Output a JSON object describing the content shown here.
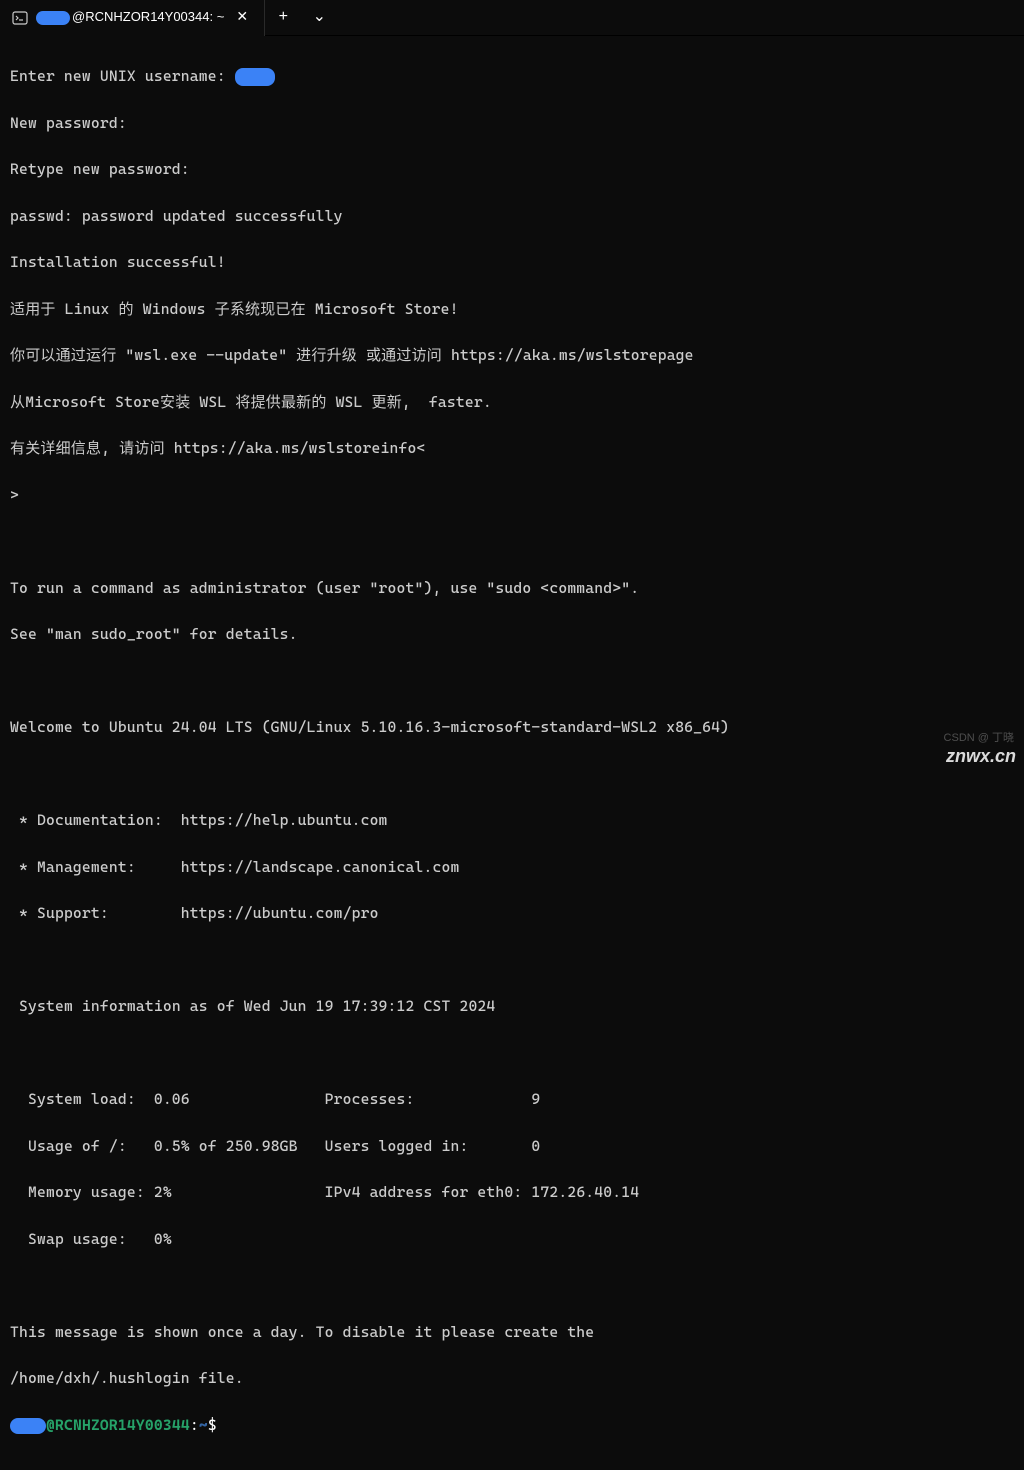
{
  "titlebar": {
    "tab_title_suffix": "@RCNHZOR14Y00344: ~",
    "close_glyph": "✕",
    "newtab_glyph": "+",
    "dropdown_glyph": "⌄"
  },
  "body": {
    "l01": "Enter new UNIX username: ",
    "l02": "New password:",
    "l03": "Retype new password:",
    "l04": "passwd: password updated successfully",
    "l05": "Installation successful!",
    "l06": "适用于 Linux 的 Windows 子系统现已在 Microsoft Store!",
    "l07": "你可以通过运行 \"wsl.exe --update\" 进行升级 或通过访问 https://aka.ms/wslstorepage",
    "l08": "从Microsoft Store安装 WSL 将提供最新的 WSL 更新,  faster.",
    "l09": "有关详细信息, 请访问 https://aka.ms/wslstoreinfo<",
    "l10": ">",
    "l11": "",
    "l12": "To run a command as administrator (user \"root\"), use \"sudo <command>\".",
    "l13": "See \"man sudo_root\" for details.",
    "l14": "",
    "l15": "Welcome to Ubuntu 24.04 LTS (GNU/Linux 5.10.16.3-microsoft-standard-WSL2 x86_64)",
    "l16": "",
    "l17": " * Documentation:  https://help.ubuntu.com",
    "l18": " * Management:     https://landscape.canonical.com",
    "l19": " * Support:        https://ubuntu.com/pro",
    "l20": "",
    "l21": " System information as of Wed Jun 19 17:39:12 CST 2024",
    "l22": "",
    "l23": "  System load:  0.06               Processes:             9",
    "l24": "  Usage of /:   0.5% of 250.98GB   Users logged in:       0",
    "l25": "  Memory usage: 2%                 IPv4 address for eth0: 172.26.40.14",
    "l26": "  Swap usage:   0%",
    "l27": "",
    "l28": "This message is shown once a day. To disable it please create the",
    "l29": "/home/dxh/.hushlogin file."
  },
  "prompt": {
    "at_host": "@RCNHZOR14Y00344",
    "colon": ":",
    "path": "~",
    "dollar": "$"
  },
  "watermark": {
    "main": "znwx.cn",
    "sub": "CSDN @ 丁晓"
  }
}
